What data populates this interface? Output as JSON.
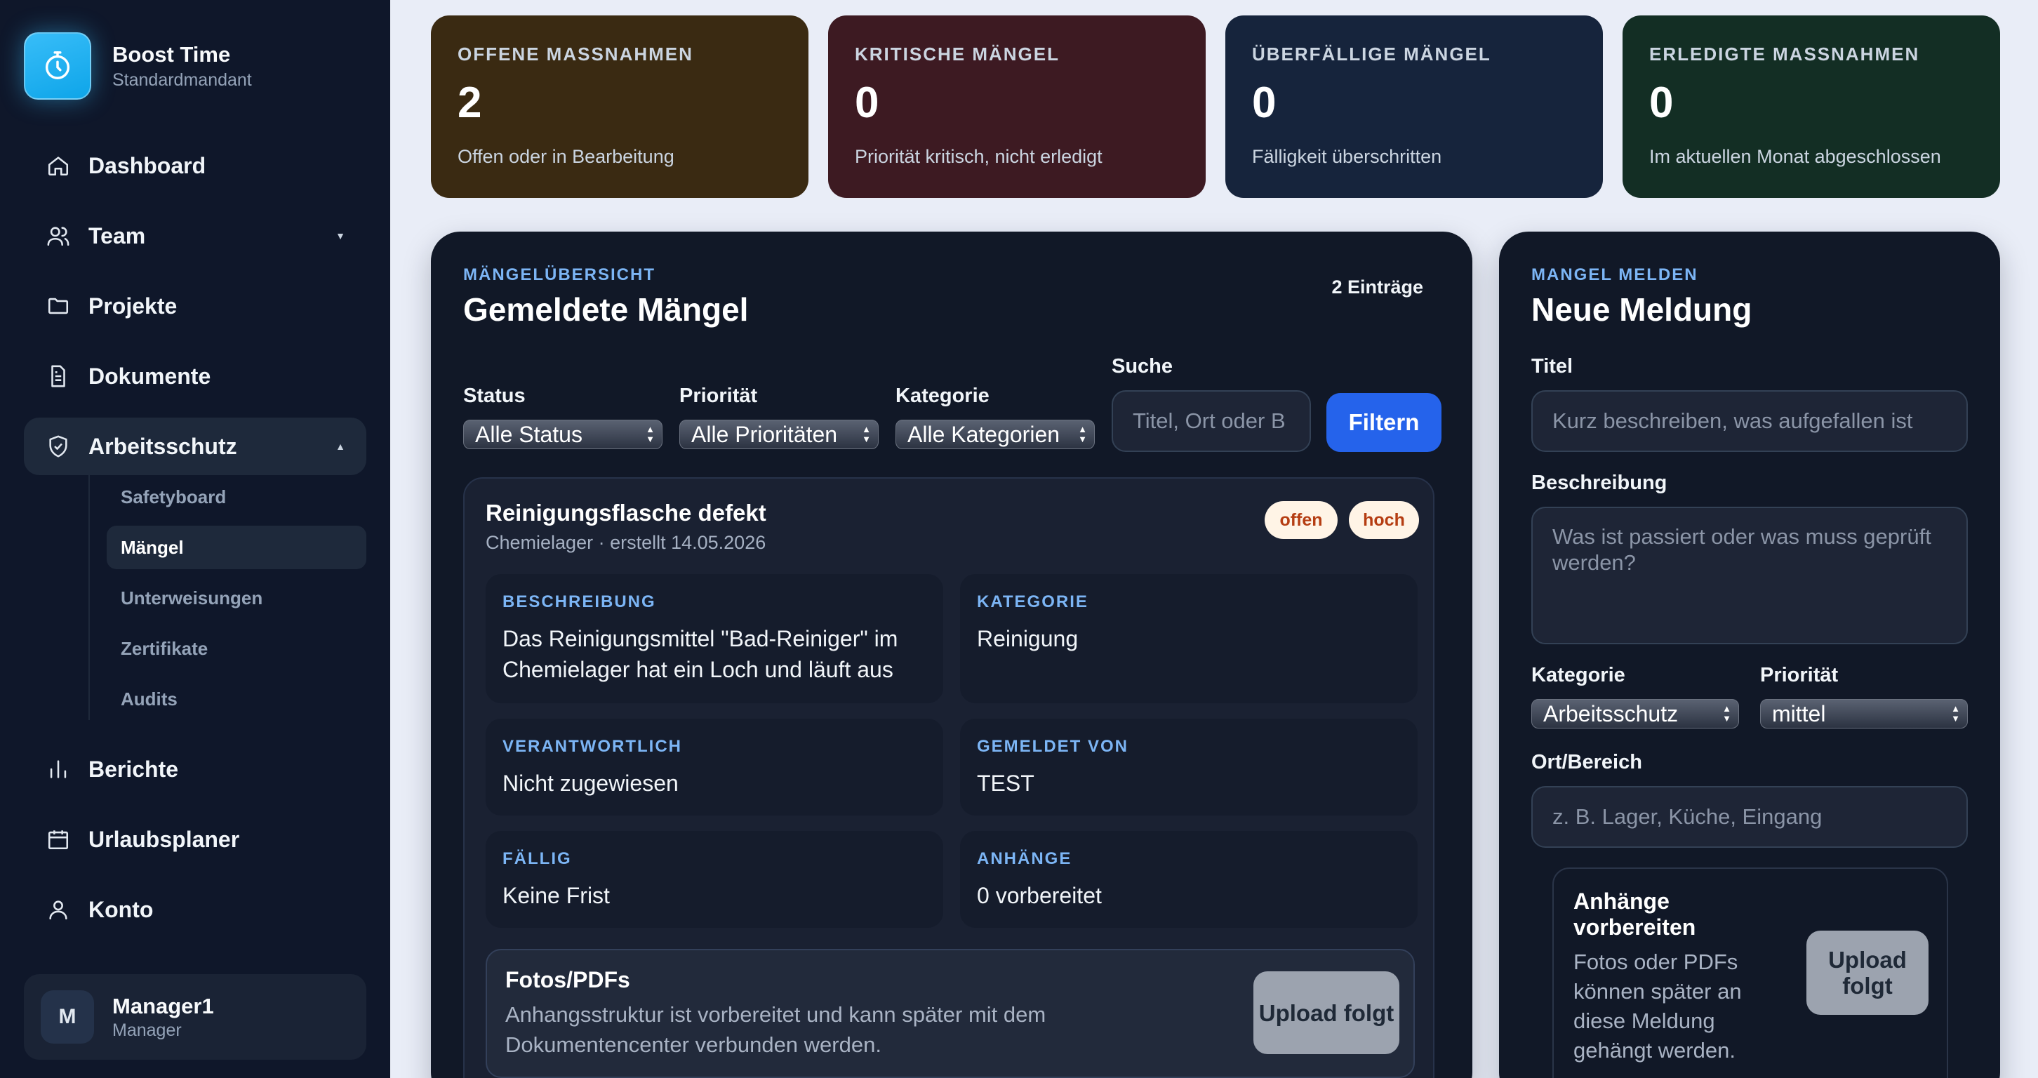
{
  "brand": {
    "name": "Boost Time",
    "tenant": "Standardmandant"
  },
  "nav": {
    "dashboard": "Dashboard",
    "team": "Team",
    "projekte": "Projekte",
    "dokumente": "Dokumente",
    "arbeitsschutz": "Arbeitsschutz",
    "sub": {
      "safetyboard": "Safetyboard",
      "maengel": "Mängel",
      "unterweisungen": "Unterweisungen",
      "zertifikate": "Zertifikate",
      "audits": "Audits"
    },
    "berichte": "Berichte",
    "urlaubsplaner": "Urlaubsplaner",
    "konto": "Konto"
  },
  "user": {
    "initial": "M",
    "name": "Manager1",
    "role": "Manager"
  },
  "stats": [
    {
      "label": "OFFENE MASSNAHMEN",
      "value": "2",
      "desc": "Offen oder in Bearbeitung",
      "color": "#3a2a12"
    },
    {
      "label": "KRITISCHE MÄNGEL",
      "value": "0",
      "desc": "Priorität kritisch, nicht erledigt",
      "color": "#3d1a22"
    },
    {
      "label": "ÜBERFÄLLIGE MÄNGEL",
      "value": "0",
      "desc": "Fälligkeit überschritten",
      "color": "#16243c"
    },
    {
      "label": "ERLEDIGTE MASSNAHMEN",
      "value": "0",
      "desc": "Im aktuellen Monat abgeschlossen",
      "color": "#132e24"
    }
  ],
  "overview": {
    "eyebrow": "MÄNGELÜBERSICHT",
    "title": "Gemeldete Mängel",
    "count": "2 Einträge",
    "filters": {
      "status_label": "Status",
      "status_value": "Alle Status",
      "priority_label": "Priorität",
      "priority_value": "Alle Prioritäten",
      "category_label": "Kategorie",
      "category_value": "Alle Kategorien",
      "search_label": "Suche",
      "search_placeholder": "Titel, Ort oder B",
      "filter_button": "Filtern"
    },
    "item": {
      "title": "Reinigungsflasche defekt",
      "meta": "Chemielager · erstellt 14.05.2026",
      "badge_status": "offen",
      "badge_priority": "hoch",
      "fields": {
        "beschreibung_label": "BESCHREIBUNG",
        "beschreibung_value": "Das Reinigungsmittel \"Bad-Reiniger\" im Chemielager hat ein Loch und läuft aus",
        "kategorie_label": "KATEGORIE",
        "kategorie_value": "Reinigung",
        "verantwortlich_label": "VERANTWORTLICH",
        "verantwortlich_value": "Nicht zugewiesen",
        "gemeldet_label": "GEMELDET VON",
        "gemeldet_value": "TEST",
        "faellig_label": "FÄLLIG",
        "faellig_value": "Keine Frist",
        "anhaenge_label": "ANHÄNGE",
        "anhaenge_value": "0 vorbereitet"
      },
      "attachments": {
        "title": "Fotos/PDFs",
        "text": "Anhangsstruktur ist vorbereitet und kann später mit dem Dokumentencenter verbunden werden.",
        "button": "Upload folgt"
      }
    }
  },
  "report": {
    "eyebrow": "MANGEL MELDEN",
    "title": "Neue Meldung",
    "titel_label": "Titel",
    "titel_placeholder": "Kurz beschreiben, was aufgefallen ist",
    "beschreibung_label": "Beschreibung",
    "beschreibung_placeholder": "Was ist passiert oder was muss geprüft werden?",
    "kategorie_label": "Kategorie",
    "kategorie_value": "Arbeitsschutz",
    "prioritaet_label": "Priorität",
    "prioritaet_value": "mittel",
    "ort_label": "Ort/Bereich",
    "ort_placeholder": "z. B. Lager, Küche, Eingang",
    "attach_title": "Anhänge vorbereiten",
    "attach_text": "Fotos oder PDFs können später an diese Meldung gehängt werden.",
    "attach_button": "Upload folgt"
  },
  "icons": {
    "logo": "stopwatch-icon",
    "dashboard": "home-icon",
    "team": "users-icon",
    "projekte": "folder-icon",
    "dokumente": "document-icon",
    "arbeitsschutz": "shield-check-icon",
    "berichte": "bar-chart-icon",
    "urlaubsplaner": "calendar-icon",
    "konto": "user-icon"
  },
  "colors": {
    "accent": "#2563eb",
    "sidebar": "#0f172a",
    "panel": "#111827",
    "badge_text": "#b53d12"
  }
}
